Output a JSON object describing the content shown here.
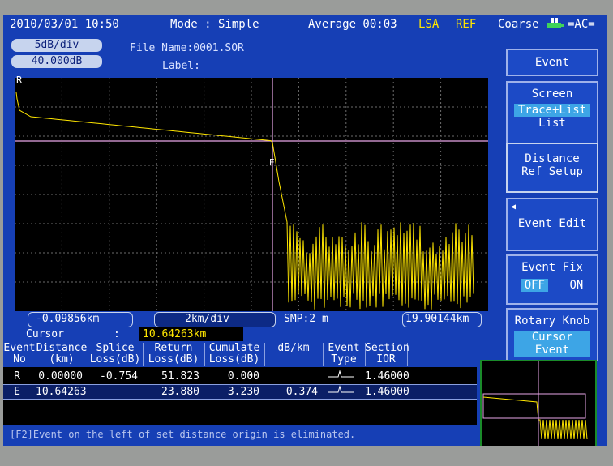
{
  "topbar": {
    "datetime": "2010/03/01 10:50",
    "mode": "Mode : Simple",
    "average": "Average 00:03",
    "lsa": "LSA",
    "ref": "REF",
    "coarse": "Coarse",
    "ac": "=AC="
  },
  "scale": {
    "vertical": "5dB/div",
    "offset": "40.000dB"
  },
  "file": {
    "name": "File Name:0001.SOR",
    "label": "Label:"
  },
  "trace": {
    "start_marker": "R",
    "event_marker": "E",
    "x_start": "-0.09856km",
    "x_div": "2km/div",
    "smp": "SMP:2 m",
    "x_end": "19.90144km"
  },
  "cursor": {
    "label": "Cursor",
    "sep": ":",
    "value": "10.64263km"
  },
  "table": {
    "headers": [
      {
        "l1": "Event",
        "l2": "No"
      },
      {
        "l1": "Distance",
        "l2": "(km)"
      },
      {
        "l1": "Splice",
        "l2": "Loss(dB)"
      },
      {
        "l1": "Return",
        "l2": "Loss(dB)"
      },
      {
        "l1": "Cumulate",
        "l2": "Loss(dB)"
      },
      {
        "l1": "dB/km",
        "l2": ""
      },
      {
        "l1": "Event",
        "l2": "Type"
      },
      {
        "l1": "Section",
        "l2": "IOR"
      }
    ],
    "rows": [
      {
        "no": "R",
        "distance": "0.00000",
        "splice": "-0.754",
        "ret": "51.823",
        "cum": "0.000",
        "dbkm": "",
        "ior": "1.46000"
      },
      {
        "no": "E",
        "distance": "10.64263",
        "splice": "",
        "ret": "23.880",
        "cum": "3.230",
        "dbkm": "0.374",
        "ior": "1.46000"
      }
    ]
  },
  "status_message": "[F2]Event on the left of set distance origin is eliminated.",
  "softkeys": {
    "event": "Event",
    "screen": "Screen",
    "screen_opt1": "Trace+List",
    "screen_opt2": "List",
    "distance1": "Distance",
    "distance2": "Ref Setup",
    "event_edit": "Event Edit",
    "event_fix": "Event Fix",
    "off": "OFF",
    "on": "ON",
    "rotary": "Rotary Knob",
    "rotary_opt1": "Cursor",
    "rotary_opt2": "Event"
  },
  "colors": {
    "trace": "#ffe600",
    "cursor_line": "#e9a6e8",
    "grid": "#6d6d6d",
    "screen_bg": "#163fb5"
  }
}
